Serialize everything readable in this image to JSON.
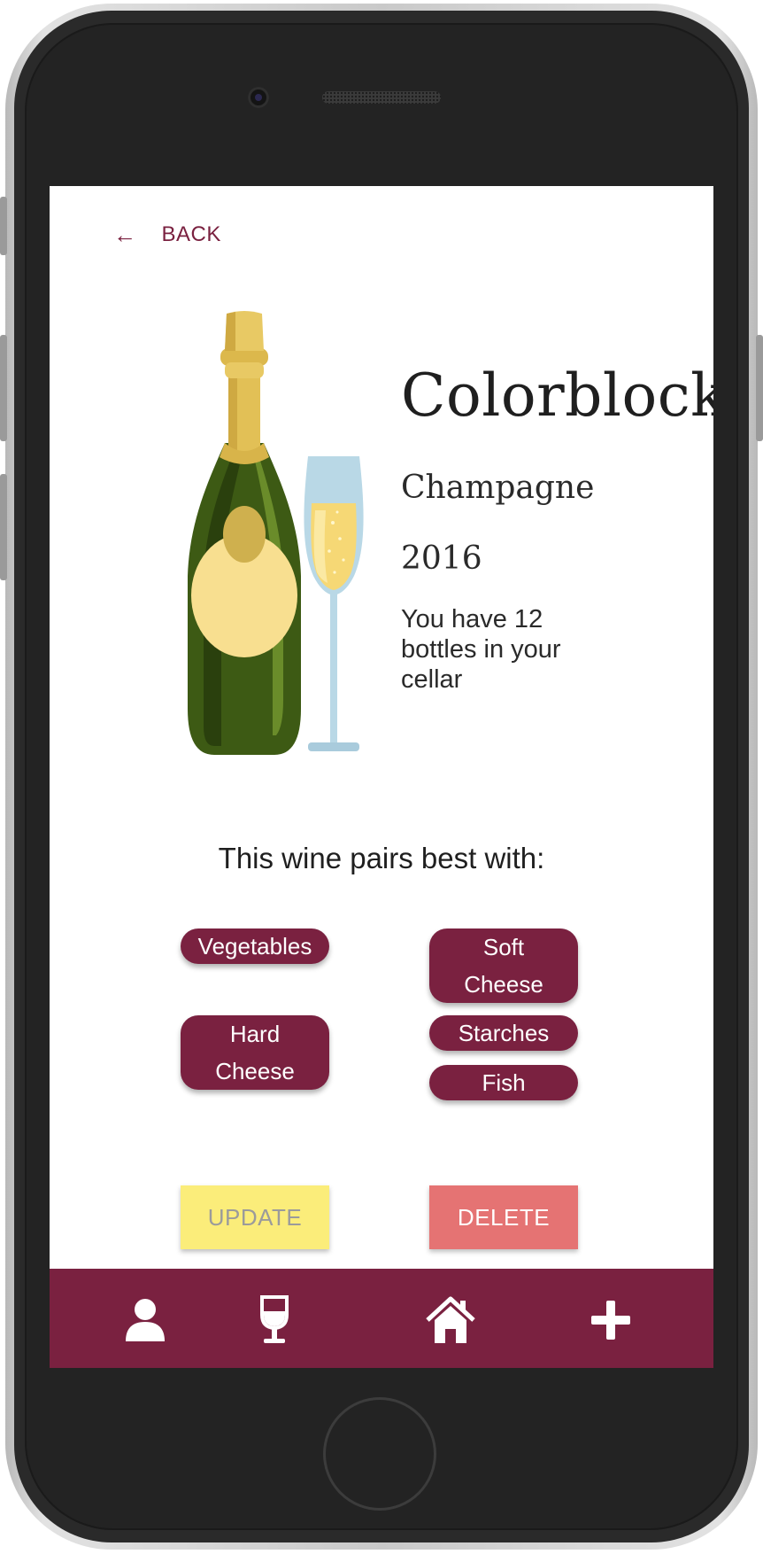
{
  "nav": {
    "back_label": "BACK",
    "back_icon": "arrow-left-icon"
  },
  "wine": {
    "name": "Colorblock",
    "type": "Champagne",
    "year": "2016",
    "cellar_text": "You have 12 bottles in your cellar"
  },
  "pairings": {
    "heading": "This wine pairs best with:",
    "items": [
      "Vegetables",
      "Soft Cheese",
      "Hard Cheese",
      "Starches",
      "Fish"
    ]
  },
  "actions": {
    "update_label": "UPDATE",
    "delete_label": "DELETE"
  },
  "bottom_nav": {
    "items": [
      {
        "icon": "user-icon"
      },
      {
        "icon": "wine-glass-icon"
      },
      {
        "icon": "home-icon"
      },
      {
        "icon": "plus-icon"
      }
    ]
  },
  "colors": {
    "brand": "#7a2140",
    "update_bg": "#fbed7a",
    "delete_bg": "#e57373"
  }
}
